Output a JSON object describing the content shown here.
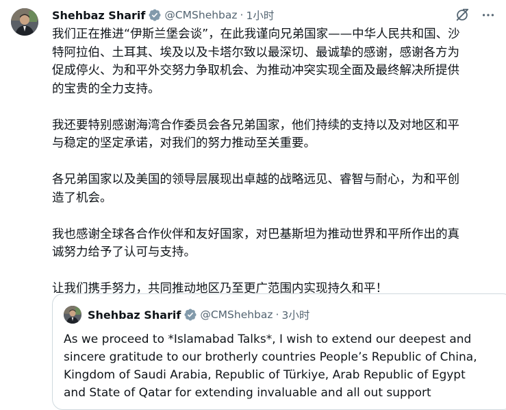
{
  "tweet": {
    "author_name": "Shehbaz Sharif",
    "handle": "@CMShehbaz",
    "separator": "·",
    "time": "1小时",
    "paragraphs": [
      [
        "我们正在推进“伊斯兰堡会谈”，在此我谨向兄弟国家——中华人民共和国、沙",
        "特阿拉伯、土耳其、埃及以及卡塔尔致以最深切、最诚挚的感谢，感谢各方为",
        "促成停火、为和平外交努力争取机会、为推动冲突实现全面及最终解决所提供",
        "的宝贵的全力支持。"
      ],
      [
        "我还要特别感谢海湾合作委员会各兄弟国家，他们持续的支持以及对地区和平",
        "与稳定的坚定承诺，对我们的努力推动至关重要。"
      ],
      [
        "各兄弟国家以及美国的领导层展现出卓越的战略远见、睿智与耐心，为和平创",
        "造了机会。"
      ],
      [
        "我也感谢全球各合作伙伴和友好国家，对巴基斯坦为推动世界和平所作出的真",
        "诚努力给予了认可与支持。"
      ],
      [
        "让我们携手努力，共同推动地区乃至更广范围内实现持久和平！"
      ]
    ]
  },
  "quoted_tweet": {
    "author_name": "Shehbaz Sharif",
    "handle": "@CMShehbaz",
    "separator": "·",
    "time": "3小时",
    "lines": [
      "As we proceed to *Islamabad Talks*, I wish to extend our deepest and",
      "sincere gratitude to our brotherly countries People’s Republic of China,",
      "Kingdom of Saudi Arabia, Republic of Türkiye, Arab Republic of Egypt",
      "and State of Qatar for extending invaluable and all out support"
    ]
  },
  "icons": {
    "verified": "verified-badge-icon",
    "grok": "grok-icon",
    "more": "more-icon"
  },
  "colors": {
    "text_primary": "#0f1419",
    "text_secondary": "#536471",
    "verified_badge": "#829aab",
    "border": "#cfd9de"
  }
}
